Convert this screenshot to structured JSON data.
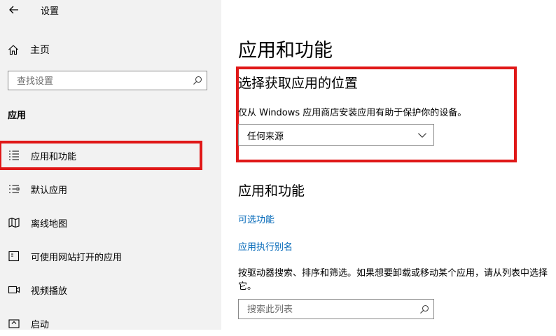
{
  "window": {
    "title": "设置"
  },
  "sidebar": {
    "home_label": "主页",
    "search_placeholder": "查找设置",
    "section_label": "应用",
    "items": [
      {
        "label": "应用和功能",
        "icon": "apps-list-icon"
      },
      {
        "label": "默认应用",
        "icon": "default-apps-icon"
      },
      {
        "label": "离线地图",
        "icon": "offline-map-icon"
      },
      {
        "label": "可使用网站打开的应用",
        "icon": "website-apps-icon"
      },
      {
        "label": "视频播放",
        "icon": "video-icon"
      },
      {
        "label": "启动",
        "icon": "startup-icon"
      }
    ]
  },
  "main": {
    "title": "应用和功能",
    "install_section": {
      "title": "选择获取应用的位置",
      "description": "仅从 Windows 应用商店安装应用有助于保护你的设备。",
      "dropdown_value": "任何来源"
    },
    "apps_section": {
      "title": "应用和功能",
      "link_optional": "可选功能",
      "link_alias": "应用执行别名",
      "description": "按驱动器搜索、排序和筛选。如果想要卸载或移动某个应用，请从列表中选择它。",
      "search_placeholder": "搜索此列表"
    }
  },
  "colors": {
    "highlight": "#e01818",
    "link": "#0067b8",
    "sidebar_bg": "#f2f2f2"
  }
}
